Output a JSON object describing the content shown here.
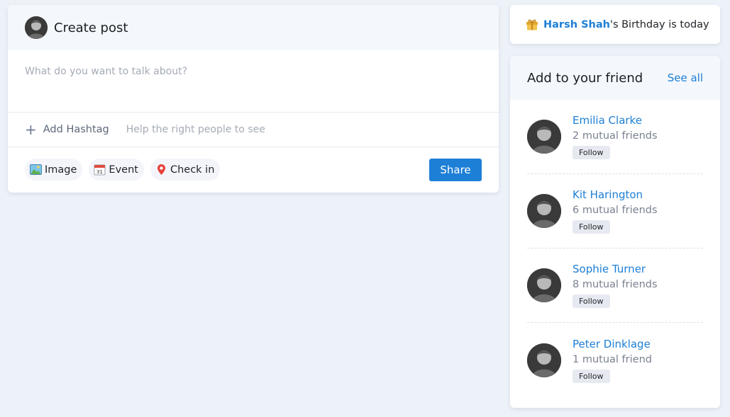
{
  "create_post": {
    "title": "Create post",
    "placeholder": "What do you want to talk about?",
    "add_hashtag_label": "Add Hashtag",
    "hashtag_hint": "Help the right people to see",
    "actions": [
      {
        "label": "Image",
        "icon": "image-icon"
      },
      {
        "label": "Event",
        "icon": "calendar-icon"
      },
      {
        "label": "Check in",
        "icon": "location-pin-icon"
      }
    ],
    "share_label": "Share"
  },
  "birthday": {
    "icon": "gift-icon",
    "name": "Harsh Shah",
    "suffix": "'s Birthday is today"
  },
  "friends": {
    "title": "Add to your friend",
    "see_all_label": "See all",
    "items": [
      {
        "name": "Emilia Clarke",
        "mutual": "2 mutual friends",
        "follow_label": "Follow"
      },
      {
        "name": "Kit Harington",
        "mutual": "6 mutual friends",
        "follow_label": "Follow"
      },
      {
        "name": "Sophie Turner",
        "mutual": "8 mutual friends",
        "follow_label": "Follow"
      },
      {
        "name": "Peter Dinklage",
        "mutual": "1 mutual friend",
        "follow_label": "Follow"
      }
    ]
  },
  "colors": {
    "accent": "#1d7fd6",
    "background": "#edf1f8",
    "header_bg": "#f4f7fc"
  }
}
